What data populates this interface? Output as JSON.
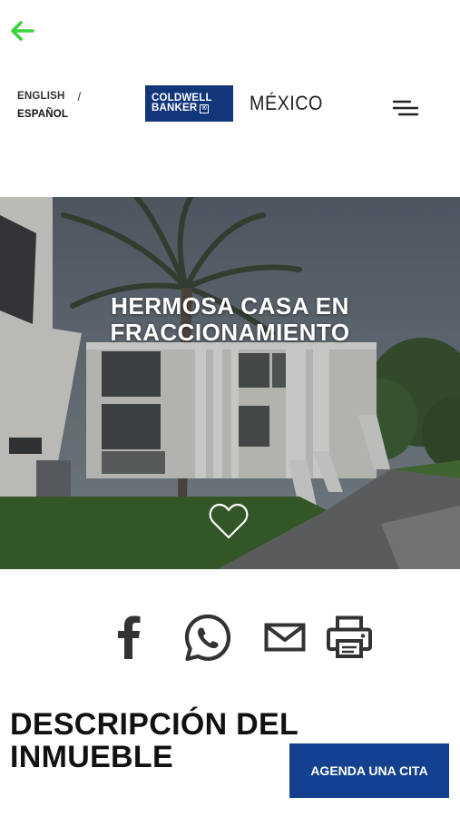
{
  "nav": {
    "back_icon": "arrow-left-icon",
    "back_color": "#3ad33a"
  },
  "languages": {
    "english": "ENGLISH",
    "separator": "/",
    "spanish": "ESPAÑOL"
  },
  "brand": {
    "logo_line1": "COLDWELL",
    "logo_line2": "BANKER",
    "logo_mark": "®",
    "country": "MÉXICO",
    "logo_color": "#12367a"
  },
  "menu": {
    "icon": "menu-icon"
  },
  "hero": {
    "title": "HERMOSA CASA EN FRACCIONAMIENTO",
    "favorite_icon": "heart-outline-icon"
  },
  "share": {
    "icons": [
      "facebook-icon",
      "whatsapp-icon",
      "mail-icon",
      "print-icon"
    ],
    "icon_color": "#333333"
  },
  "description": {
    "heading": "DESCRIPCIÓN DEL INMUEBLE"
  },
  "cta": {
    "label": "AGENDA UNA CITA",
    "color": "#13408f"
  }
}
